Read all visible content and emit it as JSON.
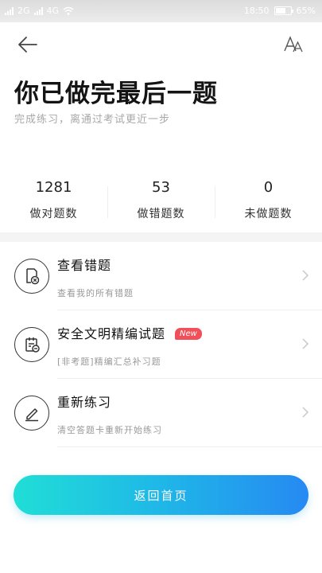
{
  "status_bar": {
    "network1": "2G",
    "network2": "4G",
    "time": "18:50",
    "battery": "65%"
  },
  "header": {
    "back_icon": "arrow-left-icon",
    "font_icon": "font-size-icon"
  },
  "title": "你已做完最后一题",
  "subtitle": "完成练习，离通过考试更近一步",
  "stats": [
    {
      "value": "1281",
      "label": "做对题数"
    },
    {
      "value": "53",
      "label": "做错题数"
    },
    {
      "value": "0",
      "label": "未做题数"
    }
  ],
  "menu": [
    {
      "title": "查看错题",
      "subtitle": "查看我的所有错题",
      "icon": "wrong-doc-icon"
    },
    {
      "title": "安全文明精编试题",
      "badge": "New",
      "subtitle": "[非考题]精编汇总补习题",
      "icon": "calendar-doc-icon"
    },
    {
      "title": "重新练习",
      "subtitle": "清空答题卡重新开始练习",
      "icon": "edit-pen-icon"
    }
  ],
  "home_button": "返回首页",
  "colors": {
    "button_gradient_start": "#20ded6",
    "button_gradient_end": "#2689f2",
    "badge": "#f0505a"
  }
}
